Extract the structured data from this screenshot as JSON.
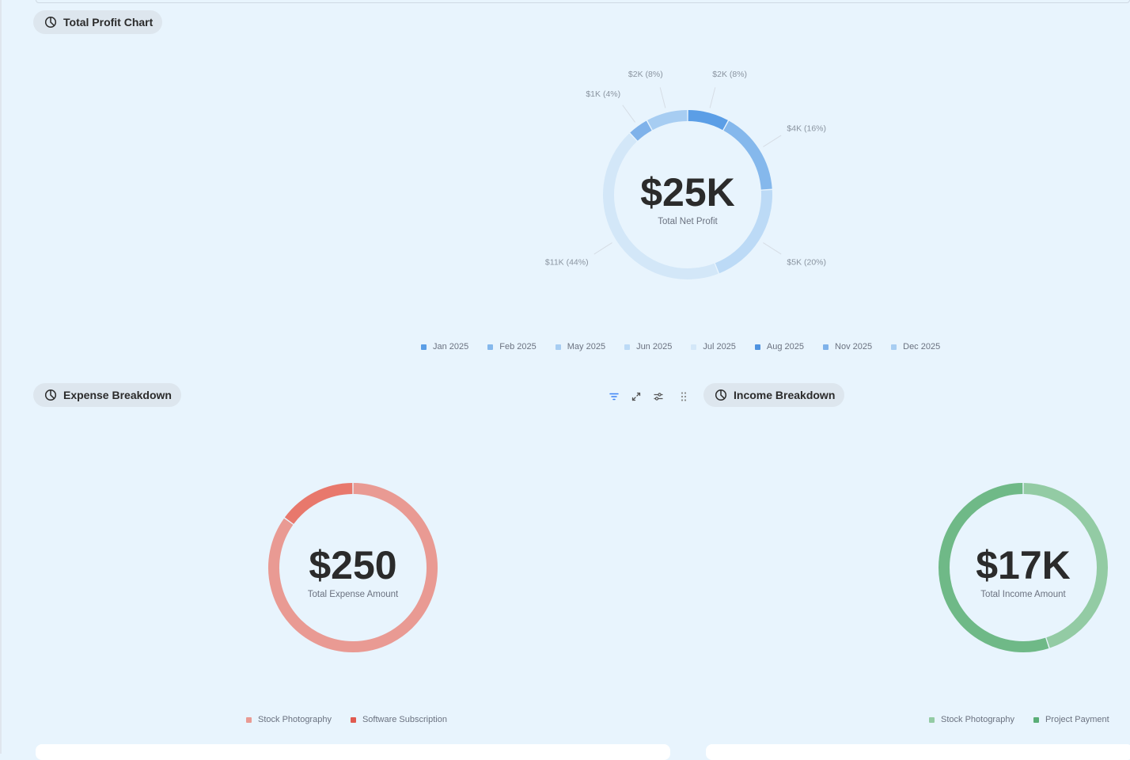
{
  "sections": {
    "profit": {
      "title": "Total Profit Chart",
      "icon": "pie-chart-icon"
    },
    "expense": {
      "title": "Expense Breakdown",
      "icon": "pie-chart-icon"
    },
    "income": {
      "title": "Income Breakdown",
      "icon": "pie-chart-icon"
    }
  },
  "toolbar": {
    "icons": [
      "filter-icon",
      "expand-icon",
      "settings-sliders-icon",
      "drag-handle-icon"
    ]
  },
  "colors": {
    "background": "#e8f4fd",
    "chip": "#dde6ee",
    "filter_icon": "#3b82f6"
  },
  "chart_data": [
    {
      "type": "pie",
      "variant": "donut",
      "center_value": "$25K",
      "center_label": "Total Net Profit",
      "slices": [
        {
          "category": "Jan 2025",
          "value": 2,
          "label": "$2K (8%)",
          "color": "#5b9ee6"
        },
        {
          "category": "Feb 2025",
          "value": 4,
          "label": "$4K (16%)",
          "color": "#85b8ec"
        },
        {
          "category": "May 2025",
          "value": 5,
          "label": "$5K (20%)",
          "color": "#bcdaf6"
        },
        {
          "category": "Jun 2025",
          "value": 11,
          "label": "$11K (44%)",
          "color": "#d3e7f8"
        },
        {
          "category": "Nov 2025",
          "value": 1,
          "label": "$1K (4%)",
          "color": "#7fb2ea"
        },
        {
          "category": "Dec 2025",
          "value": 2,
          "label": "$2K (8%)",
          "color": "#a7cdf2"
        }
      ],
      "legend": [
        {
          "label": "Jan 2025",
          "color": "#5b9ee6"
        },
        {
          "label": "Feb 2025",
          "color": "#85b8ec"
        },
        {
          "label": "May 2025",
          "color": "#a7cdf2"
        },
        {
          "label": "Jun 2025",
          "color": "#bcdaf6"
        },
        {
          "label": "Jul 2025",
          "color": "#d3e7f8"
        },
        {
          "label": "Aug 2025",
          "color": "#4f93e0"
        },
        {
          "label": "Nov 2025",
          "color": "#7fb2ea"
        },
        {
          "label": "Dec 2025",
          "color": "#a7cdf2"
        }
      ]
    },
    {
      "type": "pie",
      "variant": "donut",
      "center_value": "$250",
      "center_label": "Total Expense Amount",
      "slices": [
        {
          "category": "Stock Photography",
          "value": 85,
          "color": "#e99a93"
        },
        {
          "category": "Software Subscription",
          "value": 15,
          "color": "#e8786c"
        }
      ],
      "legend": [
        {
          "label": "Stock Photography",
          "color": "#e99a93"
        },
        {
          "label": "Software Subscription",
          "color": "#e05a50"
        }
      ]
    },
    {
      "type": "pie",
      "variant": "donut",
      "center_value": "$17K",
      "center_label": "Total Income Amount",
      "slices": [
        {
          "category": "Stock Photography",
          "value": 45,
          "color": "#93cba4"
        },
        {
          "category": "Project Payment",
          "value": 55,
          "color": "#6fb987"
        }
      ],
      "legend": [
        {
          "label": "Stock Photography",
          "color": "#93cba4"
        },
        {
          "label": "Project Payment",
          "color": "#5aae77"
        }
      ]
    }
  ]
}
